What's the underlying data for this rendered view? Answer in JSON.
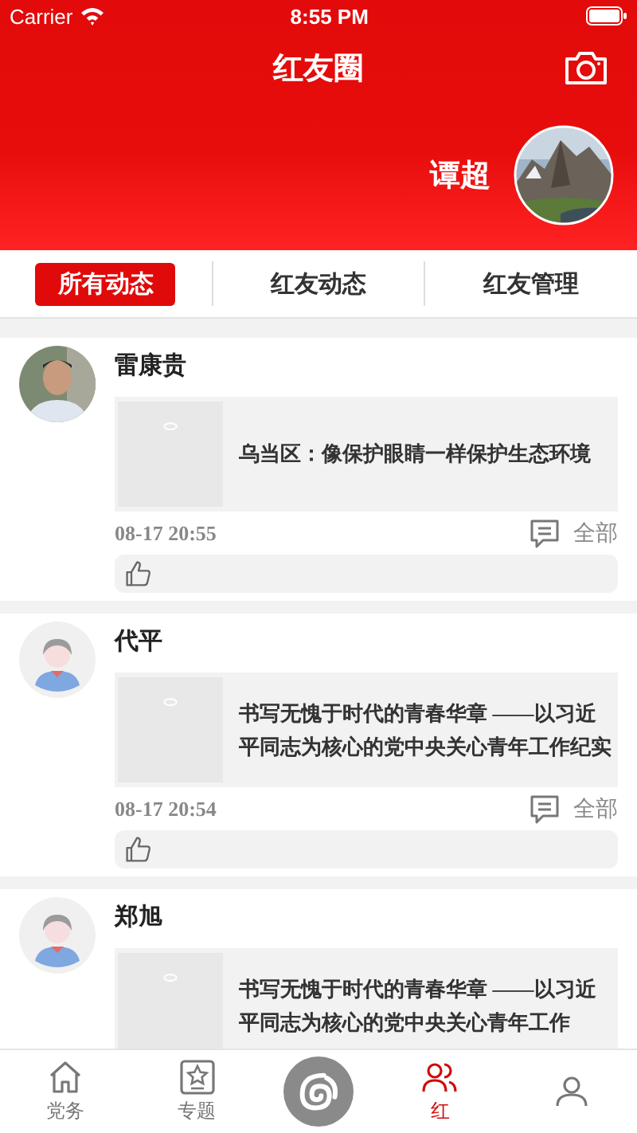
{
  "status_bar": {
    "carrier": "Carrier",
    "time": "8:55 PM"
  },
  "header": {
    "title": "红友圈",
    "user_name": "谭超"
  },
  "tabs": [
    {
      "label": "所有动态",
      "selected": true
    },
    {
      "label": "红友动态",
      "selected": false
    },
    {
      "label": "红友管理",
      "selected": false
    }
  ],
  "posts": [
    {
      "author": "雷康贵",
      "headline": "乌当区：像保护眼睛一样保护生态环境",
      "time": "08-17 20:55",
      "comment_label": "全部"
    },
    {
      "author": "代平",
      "avatar": {
        "kind": "default"
      },
      "headline": "书写无愧于时代的青春华章 ——以习近平同志为核心的党中央关心青年工作纪实",
      "time": "08-17 20:54",
      "comment_label": "全部"
    },
    {
      "author": "郑旭",
      "avatar": {
        "kind": "default"
      },
      "headline": "书写无愧于时代的青春华章 ——以习近平同志为核心的党中央关心青年工作"
    }
  ],
  "bottom_nav": [
    {
      "kind": "home",
      "label": "党务",
      "selected": false
    },
    {
      "kind": "star",
      "label": "专题",
      "selected": false
    },
    {
      "kind": "center",
      "selected": false
    },
    {
      "kind": "people",
      "label": "红",
      "selected": true
    },
    {
      "kind": "profile",
      "selected": false
    }
  ]
}
